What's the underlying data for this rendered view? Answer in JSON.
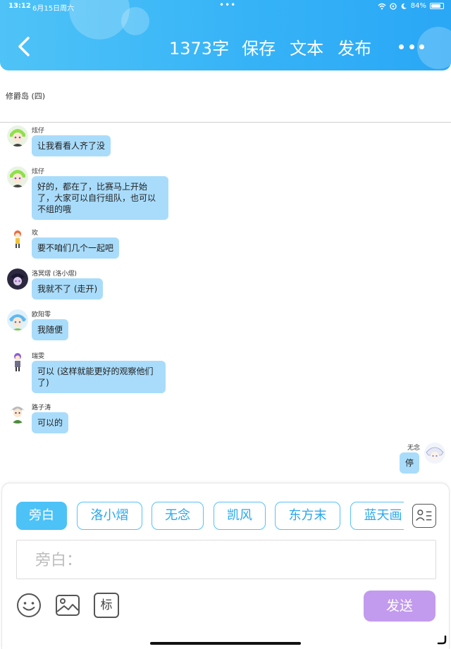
{
  "status_bar": {
    "time": "13:12",
    "date": "6月15日周六",
    "battery": "84%",
    "battery_level": 0.84
  },
  "header": {
    "word_count": "1373字",
    "save_label": "保存",
    "text_label": "文本",
    "publish_label": "发布"
  },
  "chapter": {
    "title": "修爵岛 (四)"
  },
  "messages": [
    {
      "sender": "炫仔",
      "text": "让我看看人齐了没"
    },
    {
      "sender": "炫仔",
      "text": "好的，都在了，比赛马上开始了，大家可以自行组队，也可以不组的哦"
    },
    {
      "sender": "玫",
      "text": "要不咱们几个一起吧"
    },
    {
      "sender": "洛冥熠 (洛小熠)",
      "text": "我就不了 (走开)"
    },
    {
      "sender": "欧阳零",
      "text": "我随便"
    },
    {
      "sender": "瑞雯",
      "text": "可以 (这样就能更好的观察他们了)"
    },
    {
      "sender": "路子涛",
      "text": "可以的"
    },
    {
      "sender": "无念",
      "text": "停"
    }
  ],
  "composer": {
    "roles": [
      "旁白",
      "洛小熠",
      "无念",
      "凯风",
      "东方末",
      "蓝天画"
    ],
    "active_role": "旁白",
    "input_placeholder": "旁白：",
    "send_label": "发送",
    "mark_label": "标"
  },
  "colors": {
    "header_gradient_start": "#4fc3f7",
    "header_gradient_end": "#2aa7f5",
    "bubble": "#a9dcfb",
    "chip_border": "#56c2f6",
    "chip_active": "#4cc2f7",
    "send_button": "#c29aee"
  }
}
